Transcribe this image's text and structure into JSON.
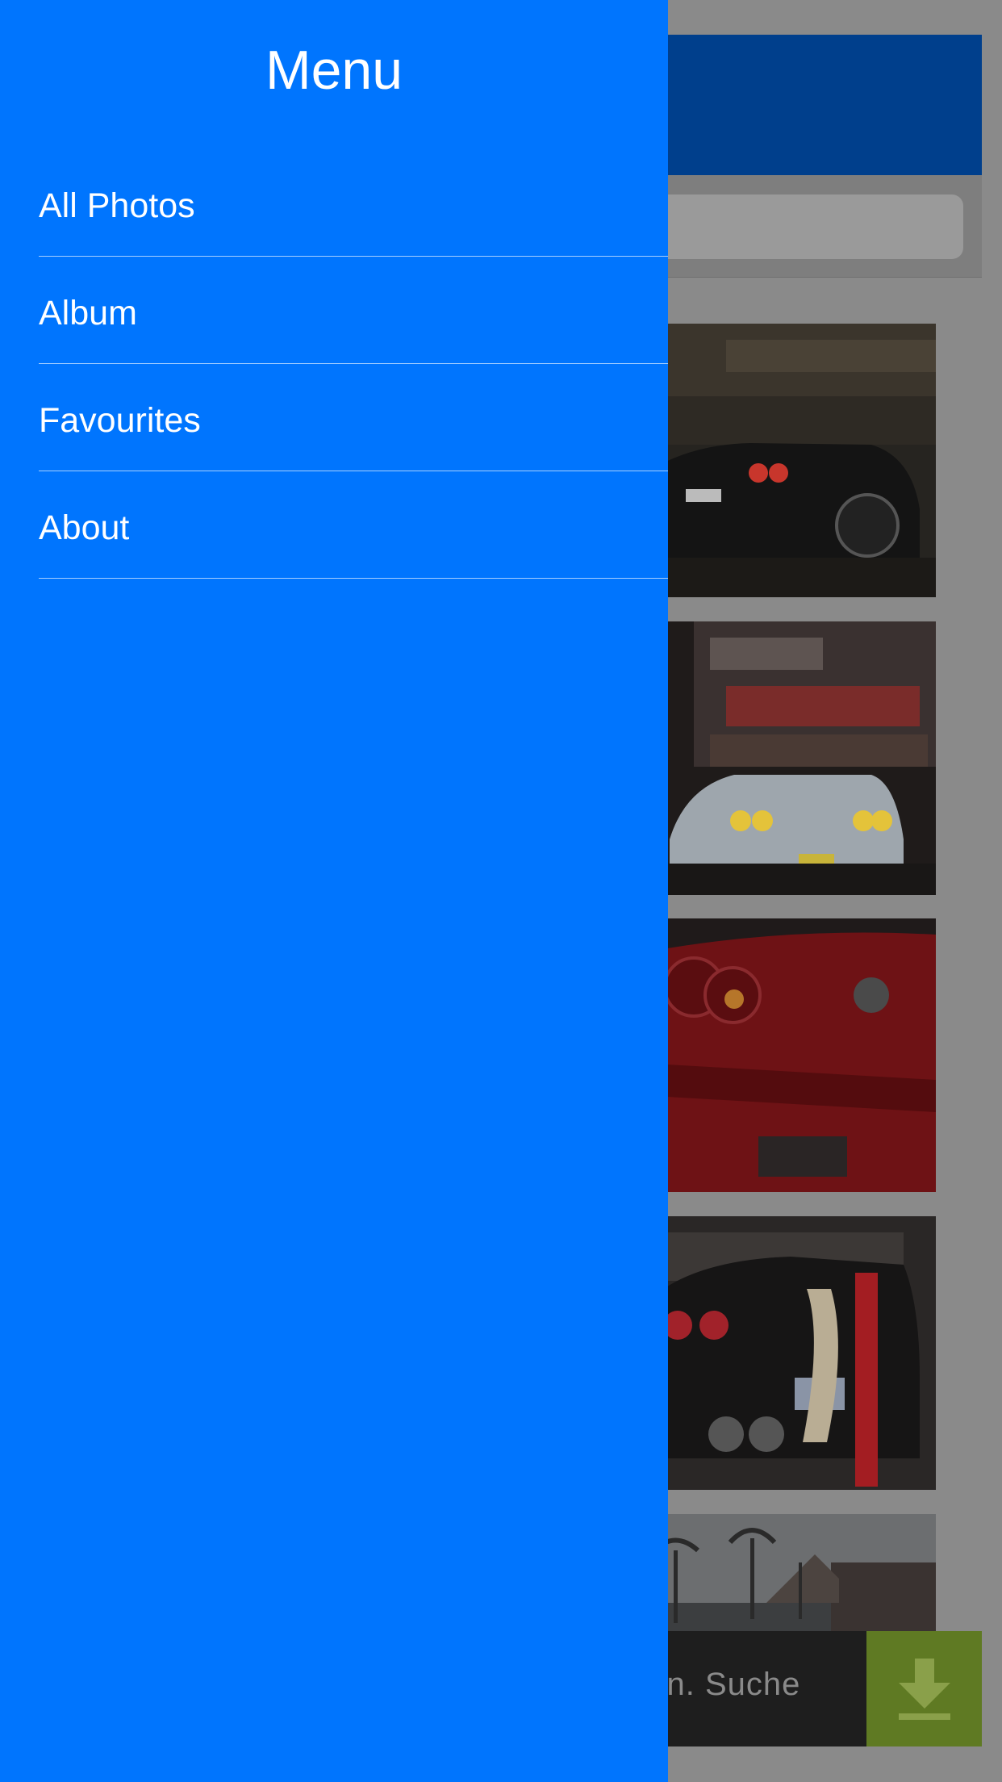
{
  "drawer": {
    "title": "Menu",
    "items": [
      {
        "label": "All Photos"
      },
      {
        "label": "Album"
      },
      {
        "label": "Favourites"
      },
      {
        "label": "About"
      }
    ]
  },
  "ad": {
    "text": "den. Suche"
  },
  "colors": {
    "drawer_bg": "#0075fe",
    "header_bg": "#003f8c",
    "ad_button_bg": "#5f7a23"
  }
}
